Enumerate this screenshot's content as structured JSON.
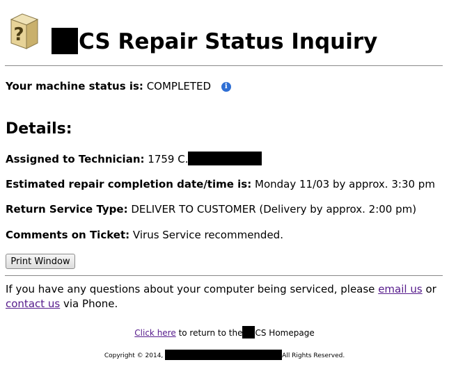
{
  "header": {
    "title_text": "CS Repair Status Inquiry"
  },
  "status": {
    "label": "Your machine status is:",
    "value": "COMPLETED"
  },
  "details": {
    "heading": "Details:",
    "technician_label": "Assigned to Technician:",
    "technician_value": "1759 C.",
    "completion_label": "Estimated repair completion date/time is:",
    "completion_value": "Monday 11/03 by approx. 3:30 pm",
    "return_label": "Return Service Type:",
    "return_value": "DELIVER TO CUSTOMER (Delivery by approx. 2:00 pm)",
    "comments_label": "Comments on Ticket:",
    "comments_value": "Virus Service recommended."
  },
  "actions": {
    "print_label": "Print Window"
  },
  "contact": {
    "text_before": "If you have any questions about your computer being serviced, please",
    "email_link": "email us",
    "text_middle": "or",
    "contact_link": "contact us",
    "text_after": "via Phone."
  },
  "footer": {
    "click_here": "Click here",
    "return_text_1": "to return to the",
    "return_text_2": "CS Homepage",
    "copyright_1": "Copyright © 2014,",
    "copyright_2": "All Rights Reserved."
  },
  "colors": {
    "link": "#551a8b",
    "info_icon": "#2f6fd4",
    "redaction": "#000000"
  }
}
